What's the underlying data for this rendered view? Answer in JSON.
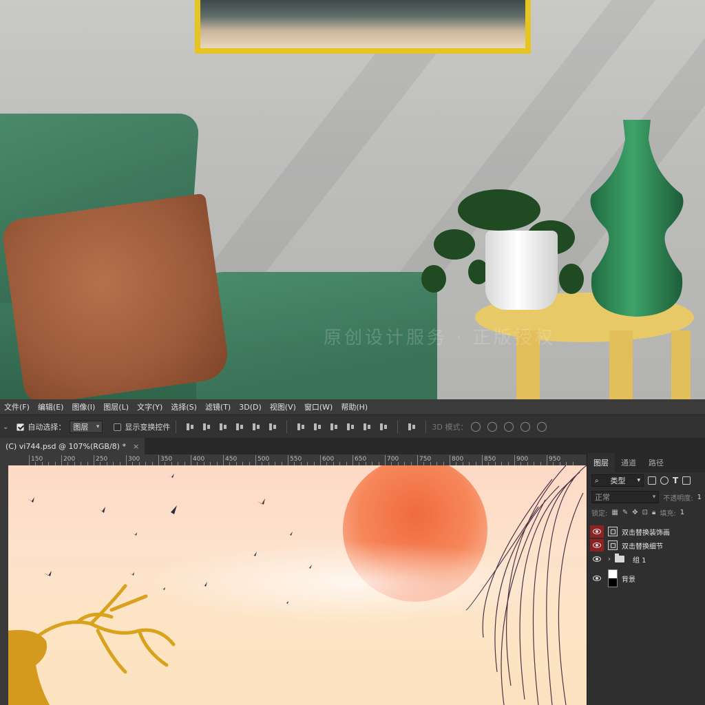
{
  "scene": {
    "watermark": "原创设计服务 · 正版授权"
  },
  "menubar": {
    "items": [
      "文件(F)",
      "编辑(E)",
      "图像(I)",
      "图层(L)",
      "文字(Y)",
      "选择(S)",
      "滤镜(T)",
      "3D(D)",
      "视图(V)",
      "窗口(W)",
      "帮助(H)"
    ]
  },
  "optionsbar": {
    "auto_select_label": "自动选择：",
    "auto_select_value": "图层",
    "show_transform_label": "显示变换控件",
    "mode_3d_label": "3D 模式："
  },
  "document": {
    "tab_title": "(C) vi744.psd @ 107%(RGB/8) *",
    "close": "×"
  },
  "ruler": {
    "labels": [
      "150",
      "200",
      "250",
      "300",
      "350",
      "400",
      "450",
      "500",
      "550",
      "600",
      "650",
      "700",
      "750",
      "800",
      "850",
      "900",
      "950"
    ]
  },
  "layers_panel": {
    "tabs": [
      "图层",
      "通道",
      "路径"
    ],
    "filter_kind": "类型",
    "blend_mode": "正常",
    "opacity_label": "不透明度:",
    "opacity_value": "1",
    "lock_label": "锁定:",
    "fill_label": "填充:",
    "fill_value": "1",
    "layers": [
      {
        "name": "双击替换装饰画",
        "type": "smart-object",
        "visible": true
      },
      {
        "name": "双击替换细节",
        "type": "smart-object",
        "visible": true
      },
      {
        "name": "组 1",
        "type": "group",
        "visible": true
      },
      {
        "name": "背景",
        "type": "background",
        "visible": true
      }
    ]
  },
  "colors": {
    "sofa": "#3b7358",
    "pillow": "#9b5a3a",
    "vase": "#2e7c4f",
    "table": "#e8c968",
    "frame": "#e6c522",
    "sun": "#f06a3f",
    "visibility_highlight": "#8e2222"
  }
}
